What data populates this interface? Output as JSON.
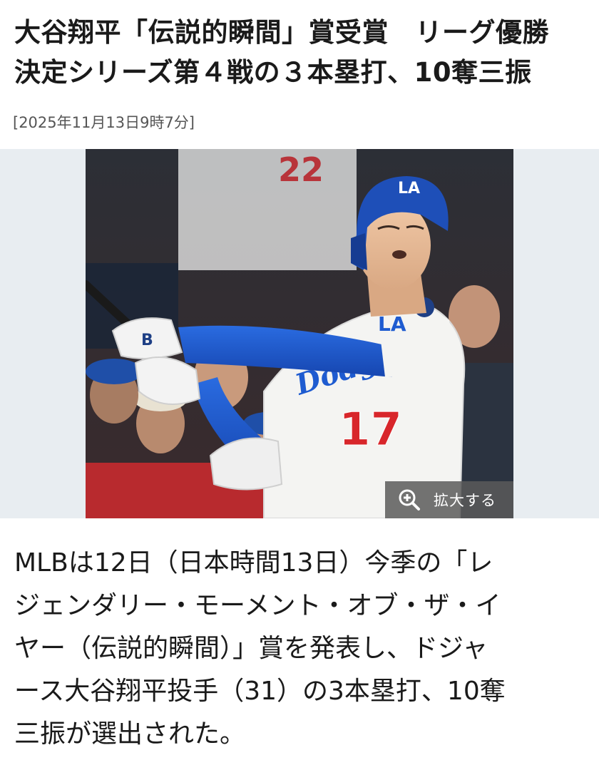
{
  "article": {
    "headline_lines": [
      "大谷翔平「伝説的瞬間」賞受賞　リーグ優勝",
      "決定シリーズ第４戦の３本塁打、10奪三振"
    ],
    "timestamp": "[2025年11月13日9時7分]",
    "body_lines": [
      "MLBは12日（日本時間13日）今季の「レ",
      "ジェンダリー・モーメント・オブ・ザ・イ",
      "ヤー（伝説的瞬間）」賞を発表し、ドジャ",
      "ース大谷翔平投手（31）の3本塁打、10奪",
      "三振が選出された。"
    ]
  },
  "photo": {
    "zoom_label": "拡大する",
    "zoom_icon": "magnifier-plus-icon",
    "helmet_logo": "LA",
    "sleeve_logo": "LA",
    "jersey_number": "17",
    "jersey_wordmark": "Dodgers",
    "background_number": "22"
  },
  "colors": {
    "text": "#1a1a1a",
    "timestamp": "#555555",
    "media_background": "#e8edf1",
    "dodger_blue": "#1e5bd0",
    "jersey_red": "#d8262b",
    "zoom_overlay": "#5a5a5a"
  }
}
